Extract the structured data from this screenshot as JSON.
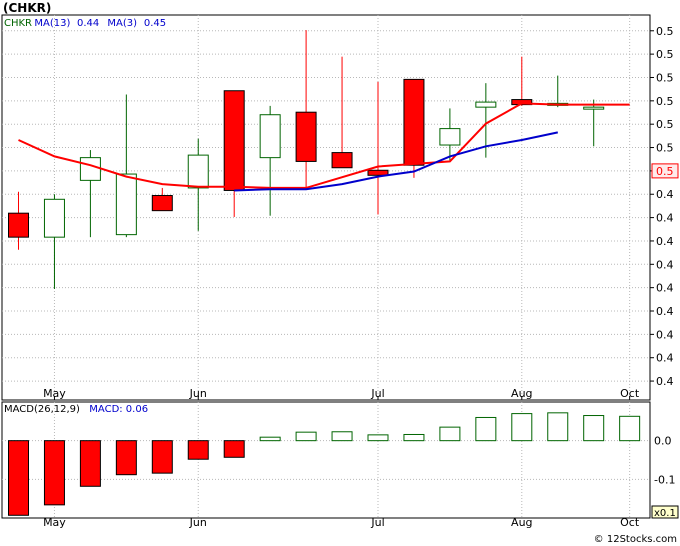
{
  "title": "(CHKR)",
  "watermark": "© 12Stocks.com",
  "colors": {
    "up": "#006400",
    "down": "#ff0000",
    "ma13": "#0000cc",
    "ma3": "#ff0000",
    "grid": "#b8b8b8",
    "macd_up": "#006400",
    "macd_down": "#ff0000",
    "last_price_bg": "#ffeaea"
  },
  "price_panel": {
    "legend": [
      {
        "text": "CHKR",
        "color": "#006400"
      },
      {
        "text": "MA(13)",
        "color": "#0000cc"
      },
      {
        "text": "0.44",
        "color": "#0000cc"
      },
      {
        "text": "MA(3)",
        "color": "#0000cc"
      },
      {
        "text": "0.45",
        "color": "#0000cc"
      }
    ],
    "y_ticks": [
      {
        "v": 0.395,
        "label": "0.4"
      },
      {
        "v": 0.4135,
        "label": "0.4"
      },
      {
        "v": 0.432,
        "label": "0.4"
      },
      {
        "v": 0.4505,
        "label": "0.4"
      },
      {
        "v": 0.469,
        "label": "0.4"
      },
      {
        "v": 0.4875,
        "label": "0.4"
      },
      {
        "v": 0.506,
        "label": "0.4"
      },
      {
        "v": 0.5245,
        "label": "0.4"
      },
      {
        "v": 0.543,
        "label": "0.4"
      },
      {
        "v": 0.5615,
        "label": "0.5"
      },
      {
        "v": 0.58,
        "label": "0.5"
      },
      {
        "v": 0.5985,
        "label": "0.5"
      },
      {
        "v": 0.617,
        "label": "0.5"
      },
      {
        "v": 0.6355,
        "label": "0.5"
      },
      {
        "v": 0.654,
        "label": "0.5"
      },
      {
        "v": 0.6725,
        "label": "0.5"
      }
    ],
    "last_price": {
      "v": 0.5615,
      "label": "0.5"
    },
    "ylim": [
      0.38,
      0.685
    ]
  },
  "macd_panel": {
    "legend": [
      {
        "text": "MACD(26,12,9)",
        "color": "#000000"
      },
      {
        "text": "MACD:",
        "color": "#0000cc"
      },
      {
        "text": "0.06",
        "color": "#0000cc"
      }
    ],
    "y_ticks": [
      {
        "v": 0.0,
        "label": "0.0"
      },
      {
        "v": -0.1,
        "label": "-0.1"
      }
    ],
    "scale_label": "x0.1",
    "ylim": [
      -0.2,
      0.1
    ]
  },
  "x_labels": [
    {
      "i": 1,
      "label": "May"
    },
    {
      "i": 5,
      "label": "Jun"
    },
    {
      "i": 10,
      "label": "Jul"
    },
    {
      "i": 14,
      "label": "Aug"
    },
    {
      "i": 17,
      "label": "Oct"
    }
  ],
  "chart_data": {
    "type": "candlestick",
    "series": [
      {
        "name": "CHKR",
        "candles": [
          {
            "o": 0.528,
            "h": 0.545,
            "l": 0.499,
            "c": 0.509
          },
          {
            "o": 0.509,
            "h": 0.543,
            "l": 0.468,
            "c": 0.539
          },
          {
            "o": 0.554,
            "h": 0.578,
            "l": 0.509,
            "c": 0.572
          },
          {
            "o": 0.511,
            "h": 0.622,
            "l": 0.509,
            "c": 0.559
          },
          {
            "o": 0.542,
            "h": 0.548,
            "l": 0.531,
            "c": 0.53
          },
          {
            "o": 0.548,
            "h": 0.587,
            "l": 0.514,
            "c": 0.574
          },
          {
            "o": 0.625,
            "h": 0.625,
            "l": 0.525,
            "c": 0.546
          },
          {
            "o": 0.572,
            "h": 0.613,
            "l": 0.526,
            "c": 0.606
          },
          {
            "o": 0.608,
            "h": 0.673,
            "l": 0.547,
            "c": 0.569
          },
          {
            "o": 0.576,
            "h": 0.652,
            "l": 0.568,
            "c": 0.564
          },
          {
            "o": 0.562,
            "h": 0.632,
            "l": 0.527,
            "c": 0.558
          },
          {
            "o": 0.634,
            "h": 0.634,
            "l": 0.556,
            "c": 0.566
          },
          {
            "o": 0.582,
            "h": 0.611,
            "l": 0.569,
            "c": 0.595
          },
          {
            "o": 0.612,
            "h": 0.631,
            "l": 0.572,
            "c": 0.616
          },
          {
            "o": 0.618,
            "h": 0.652,
            "l": 0.613,
            "c": 0.614
          },
          {
            "o": 0.615,
            "h": 0.637,
            "l": 0.612,
            "c": 0.615
          },
          {
            "o": 0.612,
            "h": 0.618,
            "l": 0.581,
            "c": 0.612
          }
        ]
      },
      {
        "name": "MA(13)",
        "values": [
          null,
          null,
          null,
          null,
          null,
          null,
          0.546,
          0.547,
          0.547,
          0.551,
          0.557,
          0.561,
          0.573,
          0.581,
          0.586,
          0.592
        ]
      },
      {
        "name": "MA(3)",
        "values": [
          0.586,
          0.573,
          0.566,
          0.557,
          0.551,
          0.549,
          0.549,
          0.548,
          0.548,
          null,
          0.565,
          null,
          0.569,
          0.599,
          0.615,
          0.614,
          0.614,
          0.614
        ]
      },
      {
        "name": "MACD",
        "values": [
          -0.193,
          -0.166,
          -0.118,
          -0.088,
          -0.084,
          -0.048,
          -0.043,
          0.009,
          0.022,
          0.023,
          0.015,
          0.016,
          0.035,
          0.06,
          0.07,
          0.072,
          0.065,
          0.063
        ]
      }
    ]
  }
}
